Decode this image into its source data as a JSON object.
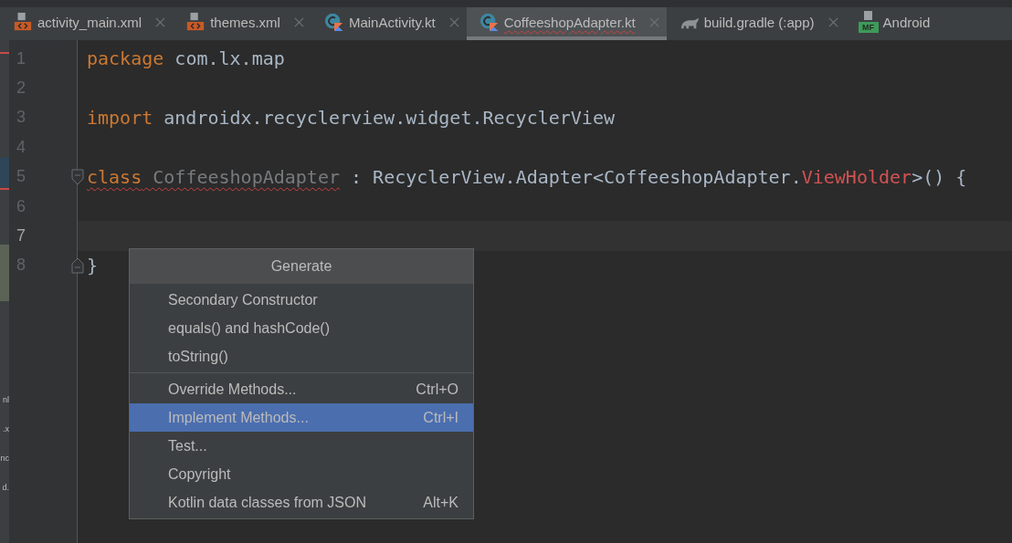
{
  "tabs": [
    {
      "label": "activity_main.xml",
      "kind": "xml",
      "selected": false,
      "has_error": false,
      "closable": true
    },
    {
      "label": "themes.xml",
      "kind": "xml",
      "selected": false,
      "has_error": false,
      "closable": true
    },
    {
      "label": "MainActivity.kt",
      "kind": "kotlin",
      "selected": false,
      "has_error": false,
      "closable": true
    },
    {
      "label": "CoffeeshopAdapter.kt",
      "kind": "kotlin",
      "selected": true,
      "has_error": true,
      "closable": true
    },
    {
      "label": "build.gradle (:app)",
      "kind": "gradle",
      "selected": false,
      "has_error": false,
      "closable": true
    },
    {
      "label": "Android",
      "kind": "manifest",
      "icon_text": "MF",
      "selected": false,
      "has_error": false,
      "closable": false
    }
  ],
  "side_panel": {
    "texts": [
      "nl",
      ".x",
      "nc",
      "d."
    ]
  },
  "editor": {
    "lines": [
      {
        "number": "1",
        "current": false,
        "kind": "plain",
        "tokens": [
          {
            "text": "package",
            "kind": "keyword",
            "squiggle": false
          },
          {
            "text": " com.lx.map",
            "kind": "plain",
            "squiggle": false
          }
        ]
      },
      {
        "number": "2",
        "current": false,
        "kind": "plain"
      },
      {
        "number": "3",
        "current": false,
        "kind": "plain",
        "tokens": [
          {
            "text": "import",
            "kind": "keyword",
            "squiggle": false
          },
          {
            "text": " androidx.recyclerview.widget.RecyclerView",
            "kind": "plain",
            "squiggle": false
          }
        ]
      },
      {
        "number": "4",
        "current": false,
        "kind": "plain"
      },
      {
        "number": "5",
        "current": false,
        "kind": "fold_start",
        "tokens": [
          {
            "text": "class",
            "kind": "keyword",
            "squiggle": true
          },
          {
            "text": " CoffeeshopAdapter",
            "kind": "unused",
            "squiggle": true
          },
          {
            "text": " : RecyclerView.Adapter<CoffeeshopAdapter.",
            "kind": "plain",
            "squiggle": false
          },
          {
            "text": "ViewHolder",
            "kind": "unresolved",
            "squiggle": false
          },
          {
            "text": ">() {",
            "kind": "plain",
            "squiggle": false
          }
        ]
      },
      {
        "number": "6",
        "current": false,
        "kind": "plain"
      },
      {
        "number": "7",
        "current": true,
        "kind": "plain"
      },
      {
        "number": "8",
        "current": false,
        "kind": "fold_end",
        "tokens": [
          {
            "text": "}",
            "kind": "plain",
            "squiggle": false
          }
        ]
      }
    ]
  },
  "popup": {
    "title": "Generate",
    "groups": [
      [
        {
          "label": "Secondary Constructor",
          "selected": false
        },
        {
          "label": "equals() and hashCode()",
          "selected": false
        },
        {
          "label": "toString()",
          "selected": false
        }
      ],
      [
        {
          "label": "Override Methods...",
          "shortcut": "Ctrl+O",
          "selected": false
        },
        {
          "label": "Implement Methods...",
          "shortcut": "Ctrl+I",
          "selected": true
        },
        {
          "label": "Test...",
          "selected": false
        },
        {
          "label": "Copyright",
          "selected": false
        },
        {
          "label": "Kotlin data classes from JSON",
          "shortcut": "Alt+K",
          "selected": false
        }
      ]
    ]
  }
}
